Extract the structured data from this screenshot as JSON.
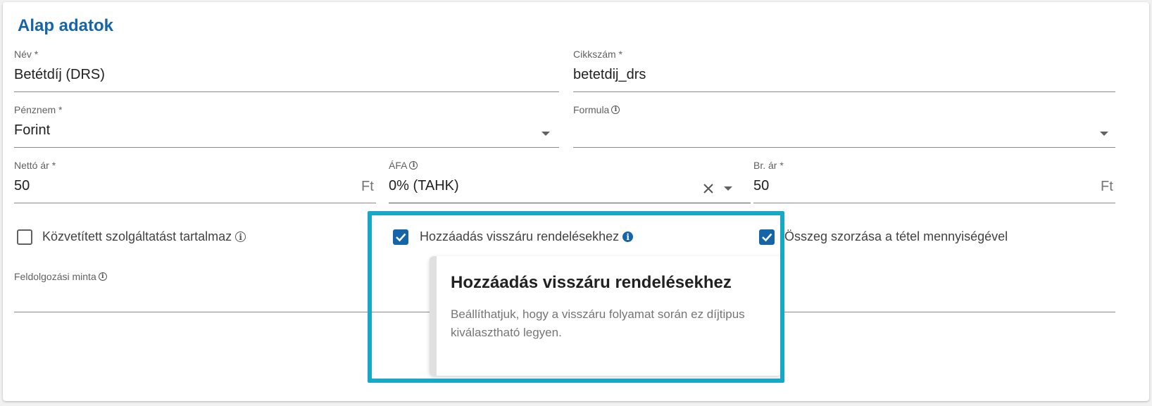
{
  "section": {
    "title": "Alap adatok"
  },
  "fields": {
    "name": {
      "label": "Név *",
      "value": "Betétdíj (DRS)"
    },
    "sku": {
      "label": "Cikkszám *",
      "value": "betetdij_drs"
    },
    "currency": {
      "label": "Pénznem *",
      "value": "Forint"
    },
    "formula": {
      "label": "Formula",
      "value": ""
    },
    "net_price": {
      "label": "Nettó ár *",
      "value": "50",
      "suffix": "Ft"
    },
    "vat": {
      "label": "ÁFA",
      "value": "0% (TAHK)"
    },
    "gross_price": {
      "label": "Br. ár *",
      "value": "50",
      "suffix": "Ft"
    },
    "processing_template": {
      "label": "Feldolgozási minta",
      "value": ""
    }
  },
  "checkboxes": {
    "intermediated": {
      "label": "Közvetített szolgáltatást tartalmaz",
      "checked": false
    },
    "add_to_returns": {
      "label": "Hozzáadás visszáru rendelésekhez",
      "checked": true
    },
    "multiply_by_qty": {
      "label": "Összeg szorzása a tétel mennyiségével",
      "checked": true
    }
  },
  "popover": {
    "title": "Hozzáadás visszáru rendelésekhez",
    "body": "Beállíthatjuk, hogy a visszáru folyamat során ez díjtipus kiválasztható legyen."
  },
  "icons": {
    "info": "info-icon",
    "dropdown": "chevron-down-icon",
    "clear": "close-icon",
    "check": "check-icon"
  },
  "colors": {
    "primary": "#1565a8",
    "highlight": "#15a8c7",
    "underline": "#8a8a8a"
  }
}
